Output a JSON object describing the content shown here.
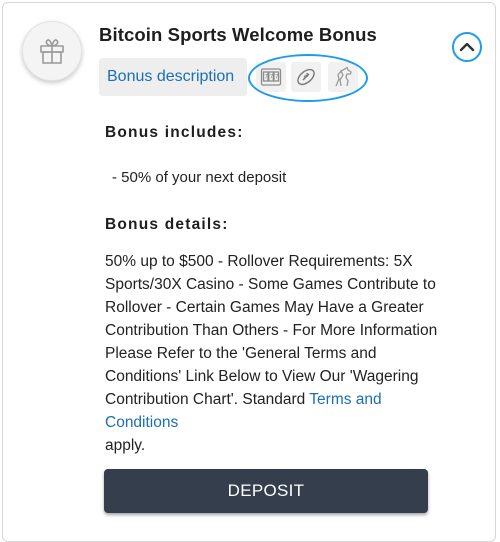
{
  "bonus": {
    "title": "Bitcoin Sports Welcome Bonus",
    "gift_icon": "gift-icon",
    "collapse_icon": "chevron-up-icon",
    "highlight_color": "#1f9be8"
  },
  "tabs": {
    "description_label": "Bonus description",
    "category_icons": [
      "slot-machine-icon",
      "football-icon",
      "horse-racing-icon"
    ]
  },
  "includes": {
    "heading": "Bonus includes:",
    "item": "- 50% of your next deposit"
  },
  "details": {
    "heading": "Bonus details:",
    "text": "50% up to $500 - Rollover Requirements: 5X Sports/30X Casino - Some Games Contribute to Rollover - Certain Games May Have a Greater Contribution Than Others - For More Information Please Refer to the 'General Terms and Conditions' Link Below to View Our 'Wagering Contribution Chart'. Standard ",
    "terms_link": "Terms and Conditions",
    "suffix": "apply."
  },
  "actions": {
    "deposit_label": "DEPOSIT",
    "button_color": "#343e4c"
  }
}
